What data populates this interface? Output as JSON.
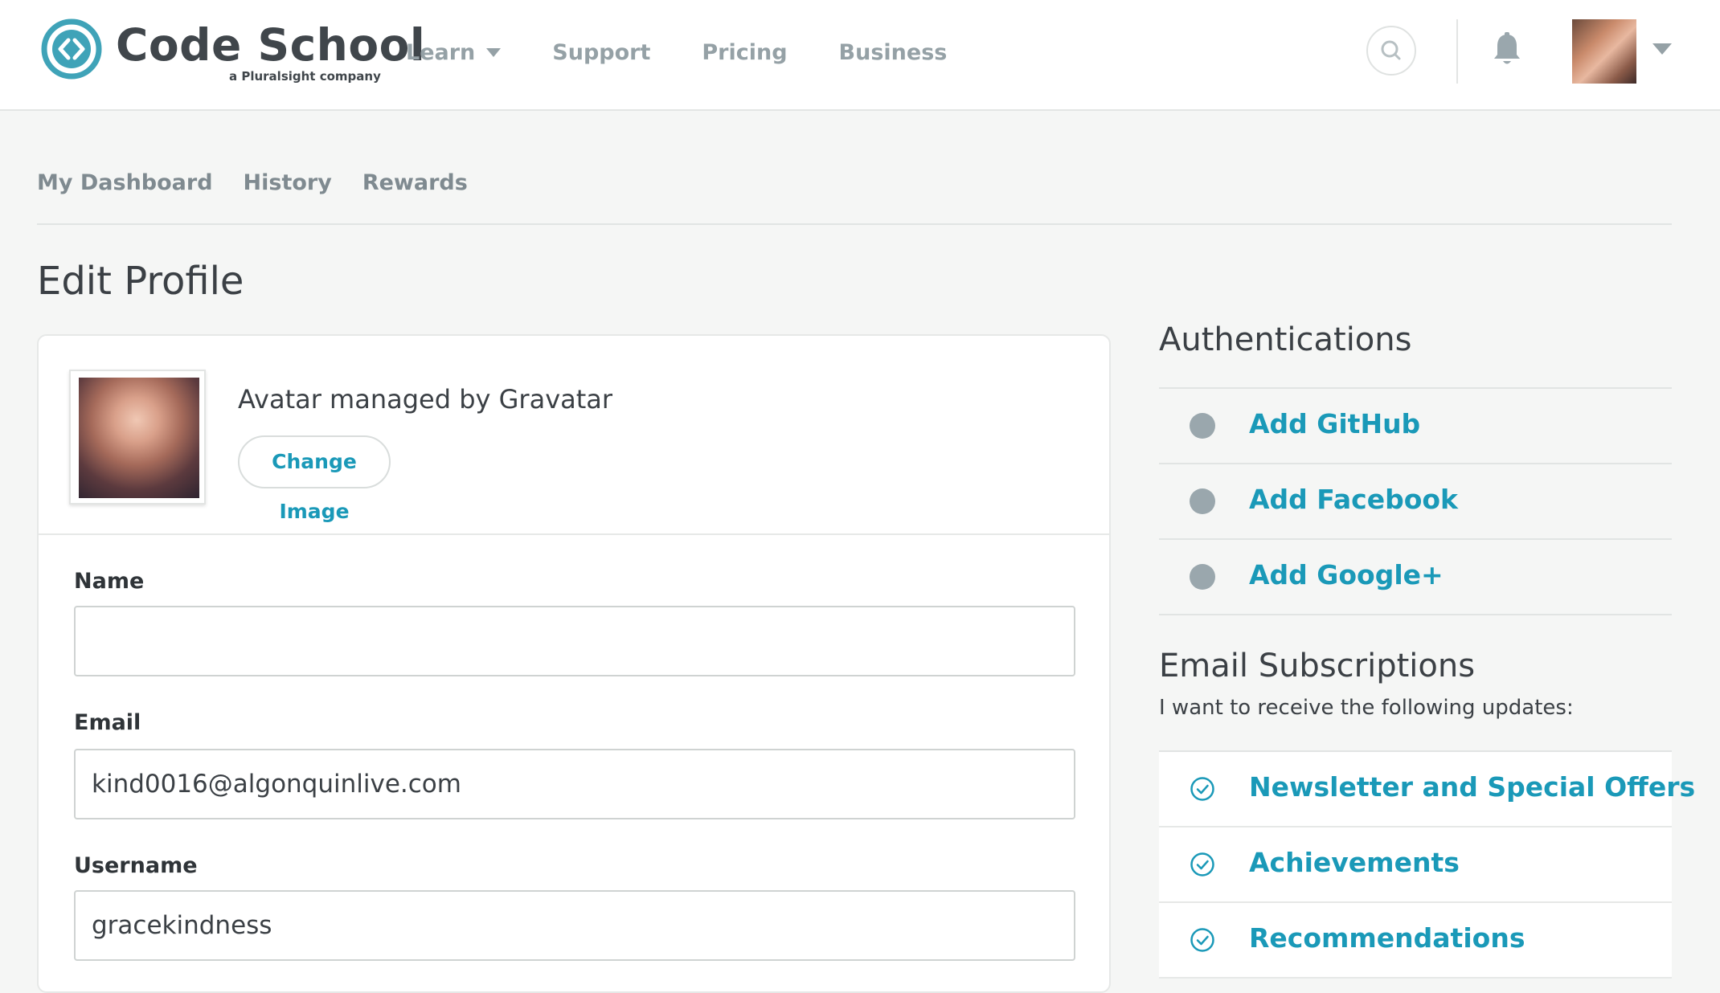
{
  "brand": {
    "name": "Code School",
    "tagline": "a Pluralsight company",
    "accent": "#1a99b8"
  },
  "top_nav": [
    {
      "label": "Learn",
      "has_dropdown": true
    },
    {
      "label": "Support",
      "has_dropdown": false
    },
    {
      "label": "Pricing",
      "has_dropdown": false
    },
    {
      "label": "Business",
      "has_dropdown": false
    }
  ],
  "header_icons": [
    "search-icon",
    "bell-icon",
    "user-avatar",
    "chevron-down-icon"
  ],
  "sub_nav": [
    {
      "label": "My Dashboard"
    },
    {
      "label": "History"
    },
    {
      "label": "Rewards"
    }
  ],
  "page_title": "Edit Profile",
  "profile": {
    "avatar_caption": "Avatar managed by Gravatar",
    "change_image_label": "Change Image",
    "fields": {
      "name": {
        "label": "Name",
        "value": ""
      },
      "email": {
        "label": "Email",
        "value": "kind0016@algonquinlive.com"
      },
      "username": {
        "label": "Username",
        "value": "gracekindness"
      }
    }
  },
  "authentications": {
    "title": "Authentications",
    "items": [
      {
        "label": "Add GitHub",
        "connected": false
      },
      {
        "label": "Add Facebook",
        "connected": false
      },
      {
        "label": "Add Google+",
        "connected": false
      }
    ]
  },
  "email_subscriptions": {
    "title": "Email Subscriptions",
    "subtitle": "I want to receive the following updates:",
    "items": [
      {
        "label": "Newsletter and Special Offers",
        "checked": true
      },
      {
        "label": "Achievements",
        "checked": true
      },
      {
        "label": "Recommendations",
        "checked": true
      }
    ]
  }
}
